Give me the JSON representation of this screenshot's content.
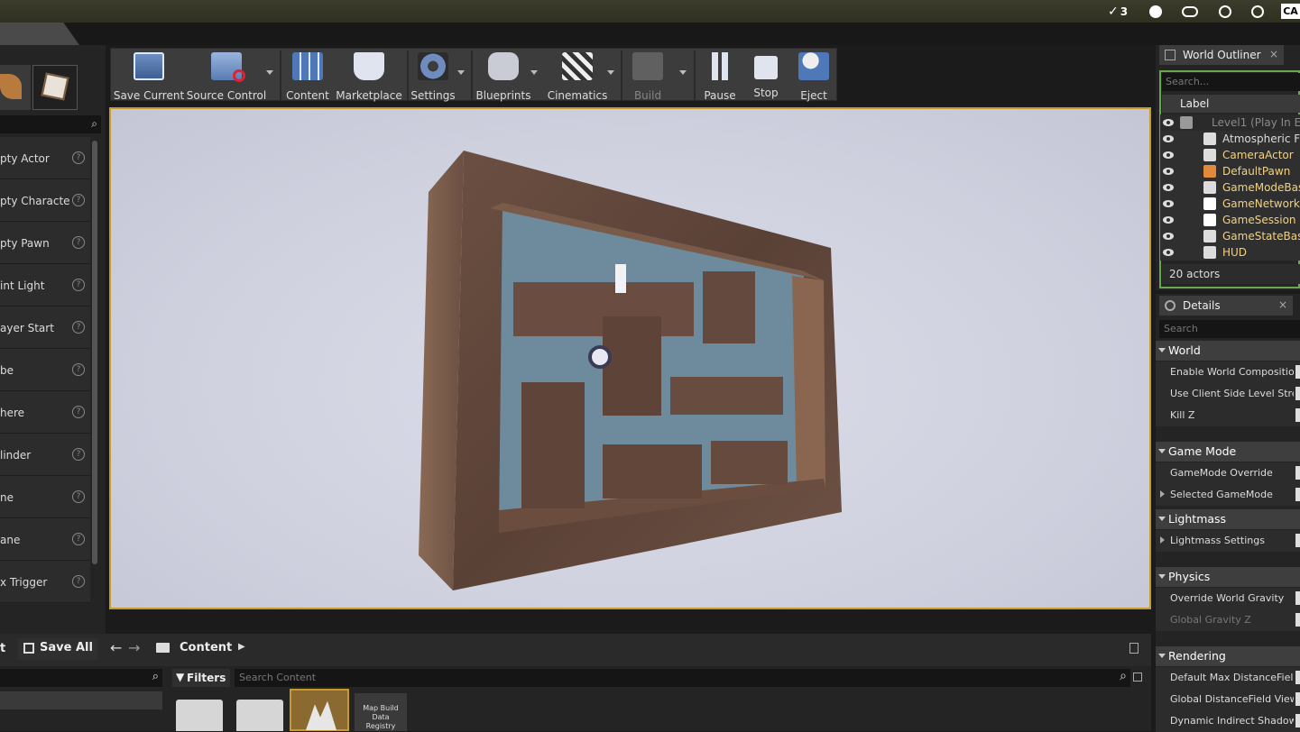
{
  "tray": {
    "task_count": "3",
    "cap": "CA"
  },
  "left_panel": {
    "items": [
      "pty Actor",
      "pty Characte",
      "pty Pawn",
      "int Light",
      "ayer Start",
      "be",
      "here",
      "linder",
      "ne",
      "ane",
      "x Trigger"
    ]
  },
  "toolbar": {
    "save_current": "Save Current",
    "source_control": "Source Control",
    "content": "Content",
    "marketplace": "Marketplace",
    "settings": "Settings",
    "blueprints": "Blueprints",
    "cinematics": "Cinematics",
    "build": "Build",
    "pause": "Pause",
    "stop": "Stop",
    "eject": "Eject"
  },
  "outliner": {
    "tab": "World Outliner",
    "close": "×",
    "search_placeholder": "Search...",
    "col_label": "Label",
    "rows": [
      {
        "label": "Level1 (Play In Edi",
        "color": "#8a8a8a"
      },
      {
        "label": "Atmospheric Fo",
        "color": "#dcdcdc"
      },
      {
        "label": "CameraActor",
        "color": "#f4d27a"
      },
      {
        "label": "DefaultPawn",
        "color": "#f4d27a"
      },
      {
        "label": "GameModeBase",
        "color": "#f4d27a"
      },
      {
        "label": "GameNetworkM",
        "color": "#f4d27a"
      },
      {
        "label": "GameSession",
        "color": "#f4d27a"
      },
      {
        "label": "GameStateBase",
        "color": "#f4d27a"
      },
      {
        "label": "HUD",
        "color": "#f4d27a"
      }
    ],
    "actor_count": "20 actors"
  },
  "details": {
    "tab": "Details",
    "close": "×",
    "search_placeholder": "Search",
    "sections": {
      "world": "World",
      "world_props": [
        "Enable World Composition",
        "Use Client Side Level Strea",
        "Kill Z"
      ],
      "game_mode": "Game Mode",
      "game_mode_props": [
        "GameMode Override",
        "Selected GameMode"
      ],
      "lightmass": "Lightmass",
      "lightmass_props": [
        "Lightmass Settings"
      ],
      "physics": "Physics",
      "physics_props": [
        "Override World Gravity",
        "Global Gravity Z"
      ],
      "rendering": "Rendering",
      "rendering_props": [
        "Default Max DistanceField",
        "Global DistanceField View D",
        "Dynamic Indirect Shadows"
      ]
    }
  },
  "bottom": {
    "t_fragment": "t",
    "save_all": "Save All",
    "breadcrumb": "Content",
    "filters": "Filters",
    "search_placeholder": "Search Content",
    "asset_map_build": "Map Build Data Registry"
  },
  "colors": {
    "accent": "#c79a2d",
    "outliner_border": "#6aa84f",
    "highlight_text": "#f4d27a"
  }
}
